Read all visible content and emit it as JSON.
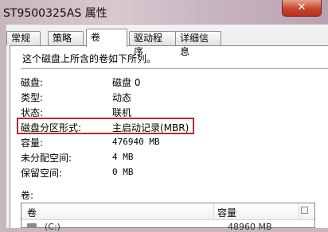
{
  "window": {
    "title": "ST9500325AS 属性",
    "close_label": "✕"
  },
  "tabs": [
    {
      "label": "常规"
    },
    {
      "label": "策略"
    },
    {
      "label": "卷"
    },
    {
      "label": "驱动程序"
    },
    {
      "label": "详细信息"
    }
  ],
  "active_tab": "卷",
  "intro_text": "这个磁盘上所含的卷如下所列。",
  "properties": [
    {
      "label": "磁盘:",
      "value": "磁盘 0"
    },
    {
      "label": "类型:",
      "value": "动态"
    },
    {
      "label": "状态:",
      "value": "联机"
    },
    {
      "label": "磁盘分区形式:",
      "value": "主启动记录(MBR)"
    },
    {
      "label": "容量:",
      "value": "476940 MB"
    },
    {
      "label": "未分配空间:",
      "value": "4 MB"
    },
    {
      "label": "保留空间:",
      "value": "0 MB"
    }
  ],
  "highlight_color": "#c0272d",
  "volumes": {
    "label": "卷:",
    "columns": [
      "卷",
      "容量"
    ],
    "rows": [
      {
        "name": "(C:)",
        "size": "48960 MB"
      }
    ]
  }
}
